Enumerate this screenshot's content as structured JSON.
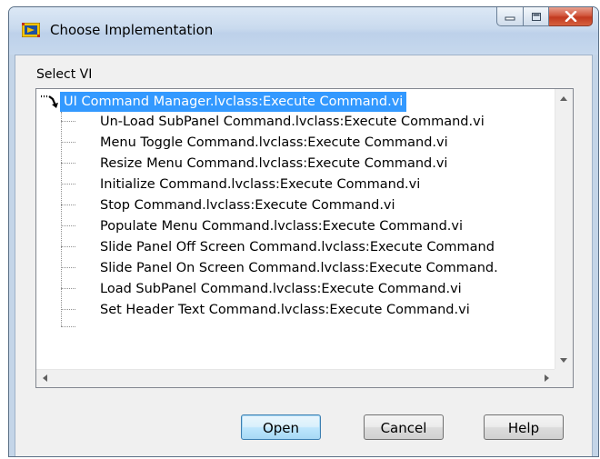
{
  "window": {
    "title": "Choose Implementation"
  },
  "dialog": {
    "select_label": "Select VI",
    "tree": {
      "root": "UI Command Manager.lvclass:Execute Command.vi",
      "children": [
        "Un-Load SubPanel Command.lvclass:Execute Command.vi",
        "Menu Toggle Command.lvclass:Execute Command.vi",
        "Resize Menu Command.lvclass:Execute Command.vi",
        "Initialize Command.lvclass:Execute Command.vi",
        "Stop Command.lvclass:Execute Command.vi",
        "Populate Menu Command.lvclass:Execute Command.vi",
        "Slide Panel Off Screen Command.lvclass:Execute Command",
        "Slide Panel On Screen Command.lvclass:Execute Command.",
        "Load SubPanel Command.lvclass:Execute Command.vi",
        "Set Header Text Command.lvclass:Execute Command.vi"
      ]
    },
    "buttons": {
      "open": "Open",
      "cancel": "Cancel",
      "help": "Help"
    }
  },
  "colors": {
    "selection": "#3399ff",
    "close_button": "#c2391f"
  }
}
